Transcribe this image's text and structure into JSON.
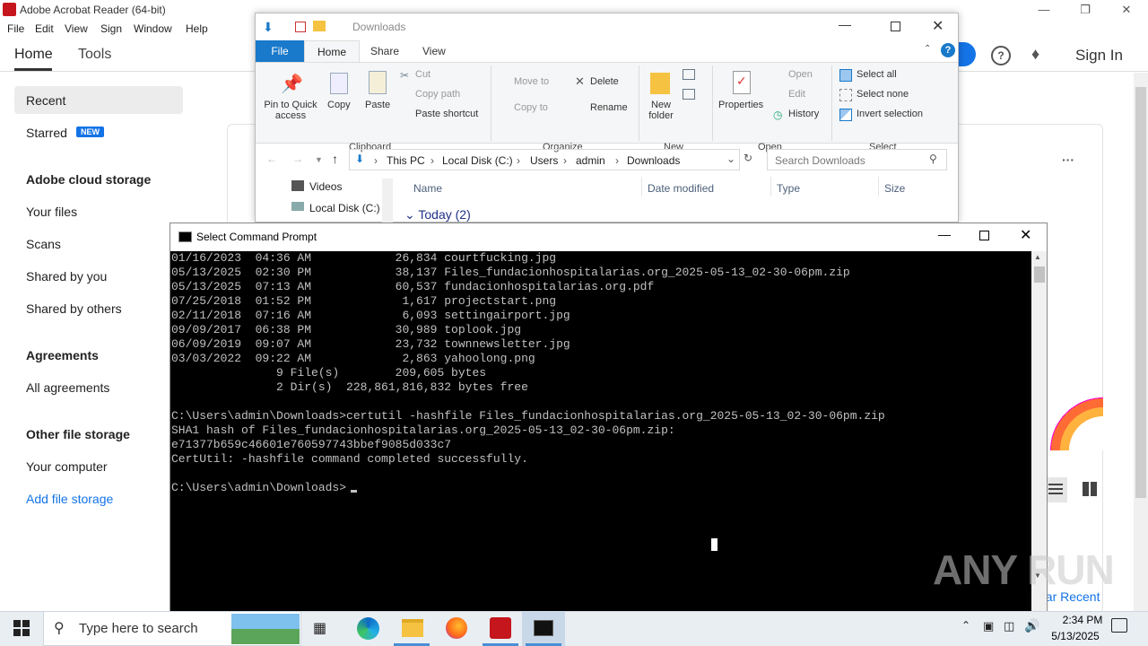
{
  "acrobat": {
    "title": "Adobe Acrobat Reader (64-bit)",
    "menu": [
      "File",
      "Edit",
      "View",
      "Sign",
      "Window",
      "Help"
    ],
    "tabs": {
      "home": "Home",
      "tools": "Tools"
    },
    "sign_in": "Sign In",
    "sidebar": {
      "recent": "Recent",
      "starred": "Starred",
      "new_badge": "NEW",
      "cloud_heading": "Adobe cloud storage",
      "your_files": "Your files",
      "scans": "Scans",
      "shared_by_you": "Shared by you",
      "shared_by_others": "Shared by others",
      "agreements_heading": "Agreements",
      "all_agreements": "All agreements",
      "other_heading": "Other file storage",
      "your_computer": "Your computer",
      "add_storage": "Add file storage"
    },
    "clear_recent": "ear Recent",
    "more_label": "···"
  },
  "explorer": {
    "title": "Downloads",
    "tabs": {
      "file": "File",
      "home": "Home",
      "share": "Share",
      "view": "View"
    },
    "clipboard": {
      "pin": "Pin to Quick",
      "pin2": "access",
      "copy": "Copy",
      "paste": "Paste",
      "cut": "Cut",
      "copy_path": "Copy path",
      "paste_shortcut": "Paste shortcut",
      "group": "Clipboard"
    },
    "organize": {
      "move_to": "Move to",
      "copy_to": "Copy to",
      "delete": "Delete",
      "rename": "Rename",
      "group": "Organize"
    },
    "new": {
      "new_folder": "New",
      "new_folder2": "folder",
      "group": "New"
    },
    "open": {
      "properties": "Properties",
      "open": "Open",
      "edit": "Edit",
      "history": "History",
      "group": "Open"
    },
    "select": {
      "select_all": "Select all",
      "select_none": "Select none",
      "invert": "Invert selection",
      "group": "Select"
    },
    "address": [
      "This PC",
      "Local Disk (C:)",
      "Users",
      "admin",
      "Downloads"
    ],
    "search_placeholder": "Search Downloads",
    "nav": {
      "videos": "Videos",
      "local_disk": "Local Disk (C:)"
    },
    "columns": {
      "name": "Name",
      "date": "Date modified",
      "type": "Type",
      "size": "Size"
    },
    "group_today": "Today (2)"
  },
  "cmd": {
    "title": "Select Command Prompt",
    "lines": [
      "01/16/2023  04:36 AM            26,834 courtfucking.jpg",
      "05/13/2025  02:30 PM            38,137 Files_fundacionhospitalarias.org_2025-05-13_02-30-06pm.zip",
      "05/13/2025  07:13 AM            60,537 fundacionhospitalarias.org.pdf",
      "07/25/2018  01:52 PM             1,617 projectstart.png",
      "02/11/2018  07:16 AM             6,093 settingairport.jpg",
      "09/09/2017  06:38 PM            30,989 toplook.jpg",
      "06/09/2019  09:07 AM            23,732 townnewsletter.jpg",
      "03/03/2022  09:22 AM             2,863 yahoolong.png",
      "               9 File(s)        209,605 bytes",
      "               2 Dir(s)  228,861,816,832 bytes free",
      "",
      "C:\\Users\\admin\\Downloads>certutil -hashfile Files_fundacionhospitalarias.org_2025-05-13_02-30-06pm.zip",
      "SHA1 hash of Files_fundacionhospitalarias.org_2025-05-13_02-30-06pm.zip:",
      "e71377b659c46601e760597743bbef9085d033c7",
      "CertUtil: -hashfile command completed successfully.",
      "",
      "C:\\Users\\admin\\Downloads>"
    ]
  },
  "watermark": "ANY RUN",
  "taskbar": {
    "search_placeholder": "Type here to search",
    "time": "2:34 PM",
    "date": "5/13/2025"
  }
}
